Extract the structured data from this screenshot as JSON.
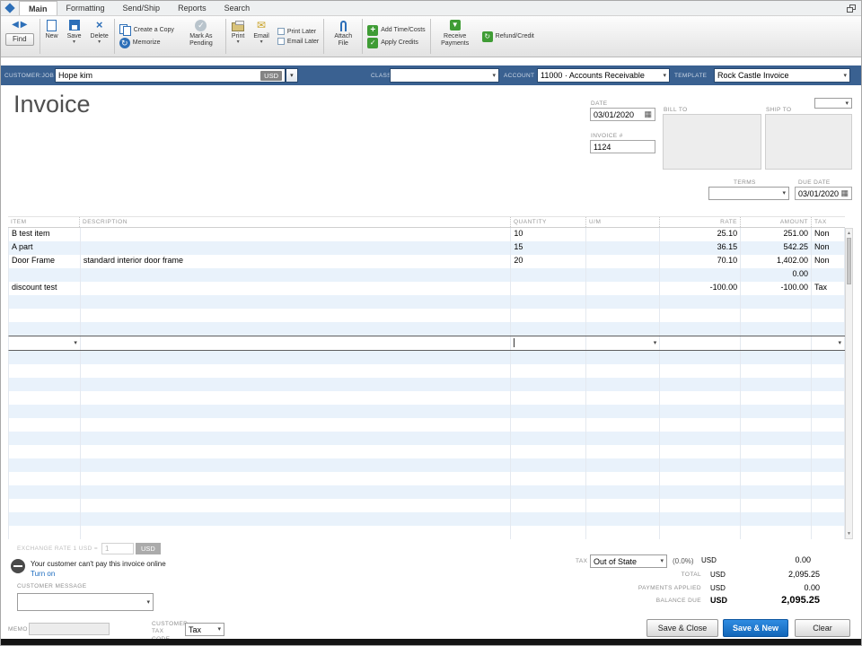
{
  "tabs": {
    "items": [
      "Main",
      "Formatting",
      "Send/Ship",
      "Reports",
      "Search"
    ],
    "active": "Main"
  },
  "toolbar": {
    "find": "Find",
    "new": "New",
    "save": "Save",
    "delete": "Delete",
    "create_copy": "Create a Copy",
    "memorize": "Memorize",
    "mark_as_pending": "Mark As Pending",
    "print": "Print",
    "email": "Email",
    "print_later": "Print Later",
    "email_later": "Email Later",
    "attach_file": "Attach File",
    "add_time_costs": "Add Time/Costs",
    "apply_credits": "Apply Credits",
    "receive_payments": "Receive Payments",
    "refund_credit": "Refund/Credit"
  },
  "header_bar": {
    "customer_job_label": "CUSTOMER:JOB",
    "customer_job_value": "Hope kim",
    "currency_badge": "USD",
    "class_label": "CLASS",
    "account_label": "ACCOUNT",
    "account_value": "11000 · Accounts Receivable",
    "template_label": "TEMPLATE",
    "template_value": "Rock Castle Invoice"
  },
  "invoice": {
    "title": "Invoice",
    "date_label": "DATE",
    "date_value": "03/01/2020",
    "invoice_no_label": "INVOICE #",
    "invoice_no_value": "1124",
    "bill_to_label": "BILL TO",
    "ship_to_label": "SHIP TO",
    "terms_label": "TERMS",
    "due_date_label": "DUE DATE",
    "due_date_value": "03/01/2020"
  },
  "table": {
    "headers": {
      "item": "ITEM",
      "description": "DESCRIPTION",
      "quantity": "QUANTITY",
      "um": "U/M",
      "rate": "RATE",
      "amount": "AMOUNT",
      "tax": "TAX"
    },
    "rows": [
      {
        "item": "B test item",
        "description": "",
        "quantity": "10",
        "um": "",
        "rate": "25.10",
        "amount": "251.00",
        "tax": "Non"
      },
      {
        "item": "A part",
        "description": "",
        "quantity": "15",
        "um": "",
        "rate": "36.15",
        "amount": "542.25",
        "tax": "Non"
      },
      {
        "item": "Door Frame",
        "description": "standard interior door frame",
        "quantity": "20",
        "um": "",
        "rate": "70.10",
        "amount": "1,402.00",
        "tax": "Non"
      },
      {
        "item": "",
        "description": "",
        "quantity": "",
        "um": "",
        "rate": "",
        "amount": "0.00",
        "tax": ""
      },
      {
        "item": "discount test",
        "description": "",
        "quantity": "",
        "um": "",
        "rate": "-100.00",
        "amount": "-100.00",
        "tax": "Tax"
      }
    ]
  },
  "footer": {
    "exchange_rate_label": "EXCHANGE RATE 1 USD =",
    "exchange_rate_value": "1",
    "exchange_rate_currency": "USD",
    "online_payment_text": "Your customer can't pay this invoice online",
    "turn_on_link": "Turn on",
    "customer_message_label": "CUSTOMER MESSAGE",
    "memo_label": "MEMO",
    "customer_tax_code_label": "CUSTOMER TAX CODE",
    "tax_code_value": "Tax"
  },
  "totals": {
    "tax_label": "TAX",
    "tax_dropdown_value": "Out of State",
    "tax_percent": "(0.0%)",
    "currency": "USD",
    "tax_amount": "0.00",
    "total_label": "TOTAL",
    "total_value": "2,095.25",
    "payments_label": "PAYMENTS APPLIED",
    "payments_value": "0.00",
    "balance_label": "BALANCE DUE",
    "balance_value": "2,095.25"
  },
  "buttons": {
    "save_close": "Save & Close",
    "save_new": "Save & New",
    "clear": "Clear"
  },
  "icons": {
    "chevron_down": "▾",
    "calendar": "▦",
    "back": "◀",
    "forward": "▶",
    "up": "▲",
    "down": "▼",
    "close_x": "×",
    "memorize_arrow": "↻",
    "envelope": "✉",
    "plus": "+",
    "check": "✓"
  }
}
